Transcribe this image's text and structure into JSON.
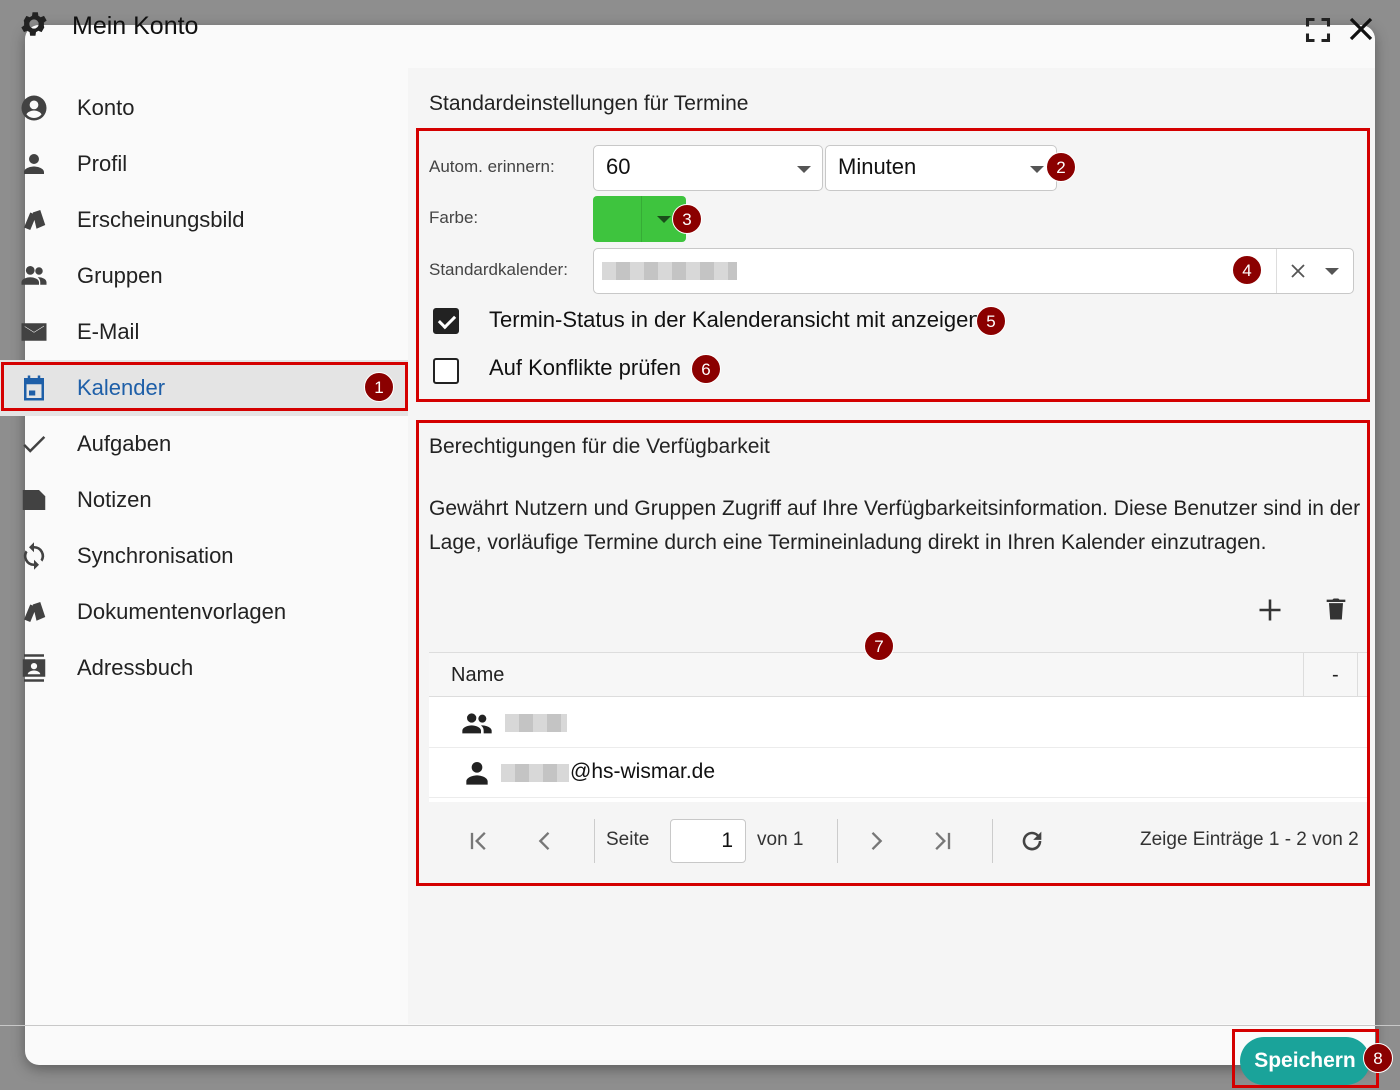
{
  "window": {
    "title": "Mein Konto"
  },
  "sidebar": {
    "items": [
      {
        "label": "Konto",
        "icon": "account-circle-icon"
      },
      {
        "label": "Profil",
        "icon": "person-icon"
      },
      {
        "label": "Erscheinungsbild",
        "icon": "palette-icon"
      },
      {
        "label": "Gruppen",
        "icon": "group-icon"
      },
      {
        "label": "E-Mail",
        "icon": "mail-icon"
      },
      {
        "label": "Kalender",
        "icon": "calendar-icon",
        "active": true
      },
      {
        "label": "Aufgaben",
        "icon": "check-icon"
      },
      {
        "label": "Notizen",
        "icon": "note-icon"
      },
      {
        "label": "Synchronisation",
        "icon": "sync-icon"
      },
      {
        "label": "Dokumentenvorlagen",
        "icon": "template-icon"
      },
      {
        "label": "Adressbuch",
        "icon": "address-book-icon"
      }
    ]
  },
  "defaults": {
    "title": "Standardeinstellungen für Termine",
    "remind_label": "Autom. erinnern:",
    "remind_value": "60",
    "remind_unit": "Minuten",
    "color_label": "Farbe:",
    "color_value": "#3ec43e",
    "calendar_label": "Standardkalender:",
    "show_status_label": "Termin-Status in der Kalenderansicht mit anzeigen",
    "show_status_checked": true,
    "conflicts_label": "Auf Konflikte prüfen",
    "conflicts_checked": false
  },
  "availability": {
    "title": "Berechtigungen für die Verfügbarkeit",
    "description": "Gewährt Nutzern und Gruppen Zugriff auf Ihre Verfügbarkeitsinformation. Diese Benutzer sind in der Lage, vorläufige Termine durch eine Termineinladung direkt in Ihren Kalender einzutragen.",
    "columns": {
      "name": "Name",
      "extra": "-"
    },
    "rows": [
      {
        "type": "group-icon",
        "text": ""
      },
      {
        "type": "person-icon",
        "text": "@hs-wismar.de"
      }
    ],
    "pager": {
      "page_label": "Seite",
      "page": "1",
      "of_label": "von 1",
      "summary": "Zeige Einträge 1 - 2 von 2"
    }
  },
  "footer": {
    "save_label": "Speichern"
  },
  "annotations": [
    "1",
    "2",
    "3",
    "4",
    "5",
    "6",
    "7",
    "8"
  ],
  "colors": {
    "accent": "#1e5fa8",
    "save": "#1aa39a",
    "annotation": "#d40000"
  }
}
